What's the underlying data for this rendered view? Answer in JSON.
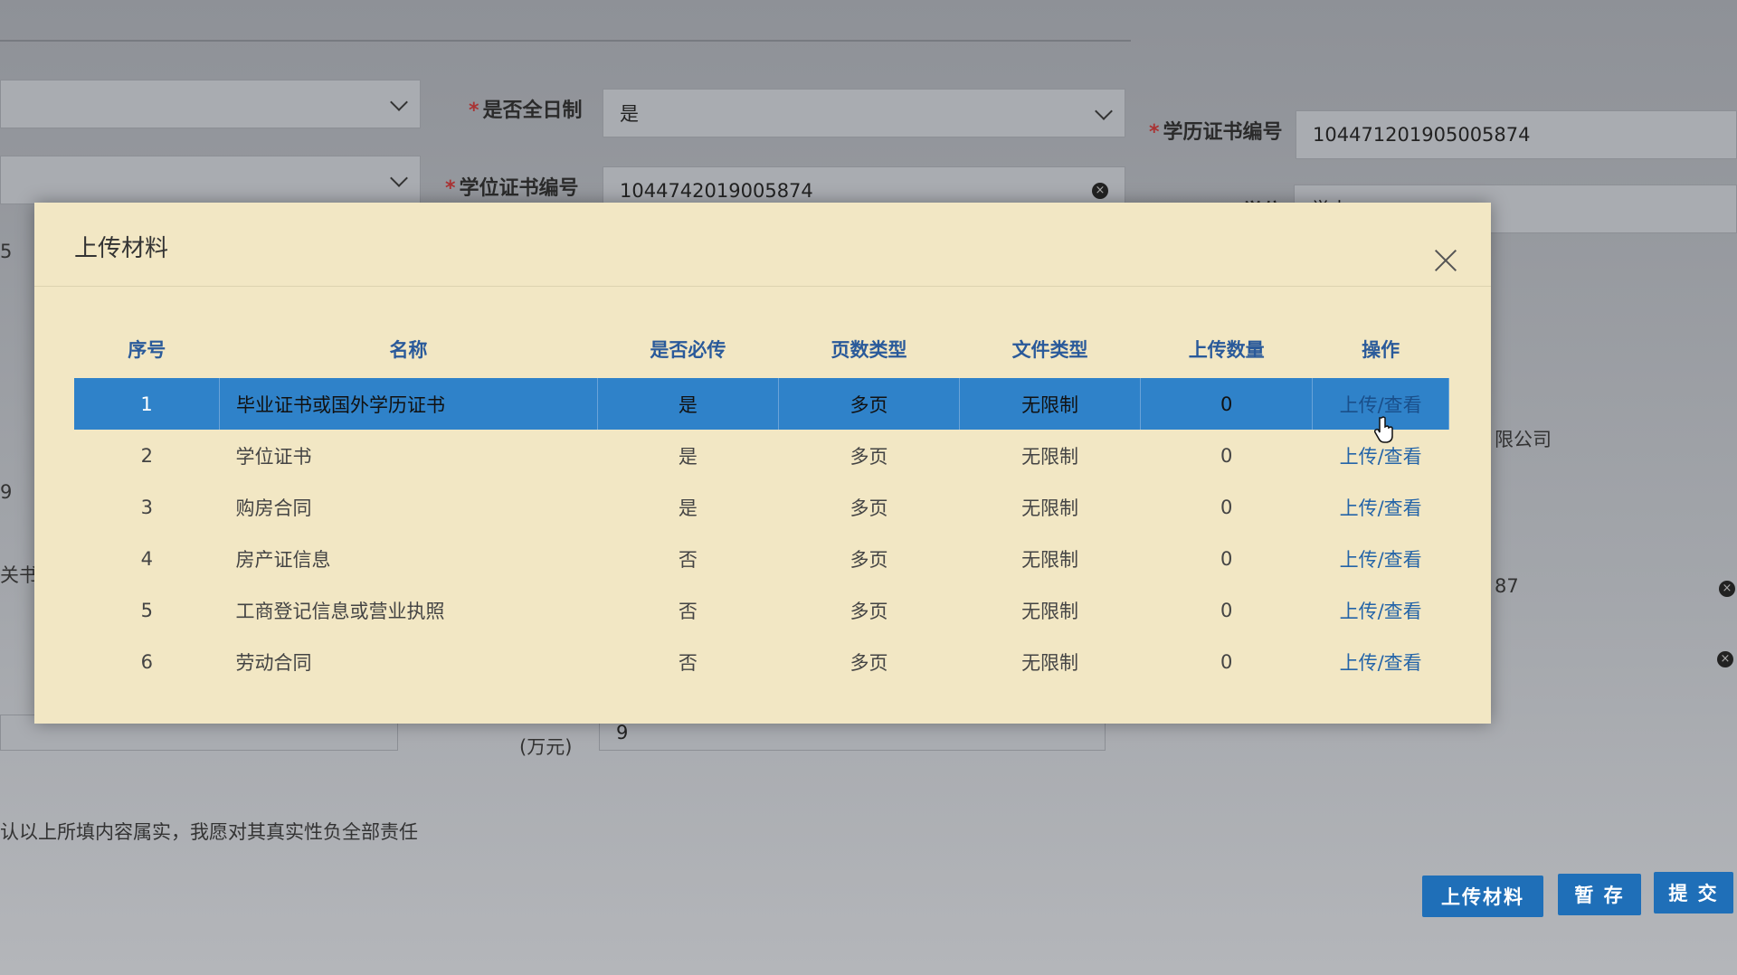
{
  "form": {
    "fulltime_label": "是否全日制",
    "fulltime_value": "是",
    "diploma_no_label": "学历证书编号",
    "diploma_no_value": "10447120190500​5874",
    "degree_no_label": "学位证书编号",
    "degree_no_value": "1044742019005874",
    "degree_label": "学位",
    "degree_value": "学士",
    "amount_unit": "(万元)",
    "amount_value": "9",
    "company_fragment": "限公司",
    "num_fragment": "87",
    "left_fragment_a": "5",
    "left_fragment_b": "9",
    "left_fragment_c": "关书",
    "declaration": "认以上所填内容属实，我愿对其真实性负全部责任"
  },
  "actions": {
    "upload_label": "上传材料",
    "save_label": "暂 存",
    "submit_label": "提 交"
  },
  "modal": {
    "title": "上传材料",
    "columns": [
      "序号",
      "名称",
      "是否必传",
      "页数类型",
      "文件类型",
      "上传数量",
      "操作"
    ],
    "rows": [
      {
        "idx": "1",
        "name": "毕业证书或国外学历证书",
        "required": "是",
        "pages": "多页",
        "filetype": "无限制",
        "count": "0",
        "action": "上传/查看"
      },
      {
        "idx": "2",
        "name": "学位证书",
        "required": "是",
        "pages": "多页",
        "filetype": "无限制",
        "count": "0",
        "action": "上传/查看"
      },
      {
        "idx": "3",
        "name": "购房合同",
        "required": "是",
        "pages": "多页",
        "filetype": "无限制",
        "count": "0",
        "action": "上传/查看"
      },
      {
        "idx": "4",
        "name": "房产证信息",
        "required": "否",
        "pages": "多页",
        "filetype": "无限制",
        "count": "0",
        "action": "上传/查看"
      },
      {
        "idx": "5",
        "name": "工商登记信息或营业执照",
        "required": "否",
        "pages": "多页",
        "filetype": "无限制",
        "count": "0",
        "action": "上传/查看"
      },
      {
        "idx": "6",
        "name": "劳动合同",
        "required": "否",
        "pages": "多页",
        "filetype": "无限制",
        "count": "0",
        "action": "上传/查看"
      }
    ]
  },
  "colors": {
    "modal_bg": "#f2e7c4",
    "selected_row": "#2f82c9",
    "primary_button": "#1f6fb8",
    "link": "#2464a8"
  }
}
